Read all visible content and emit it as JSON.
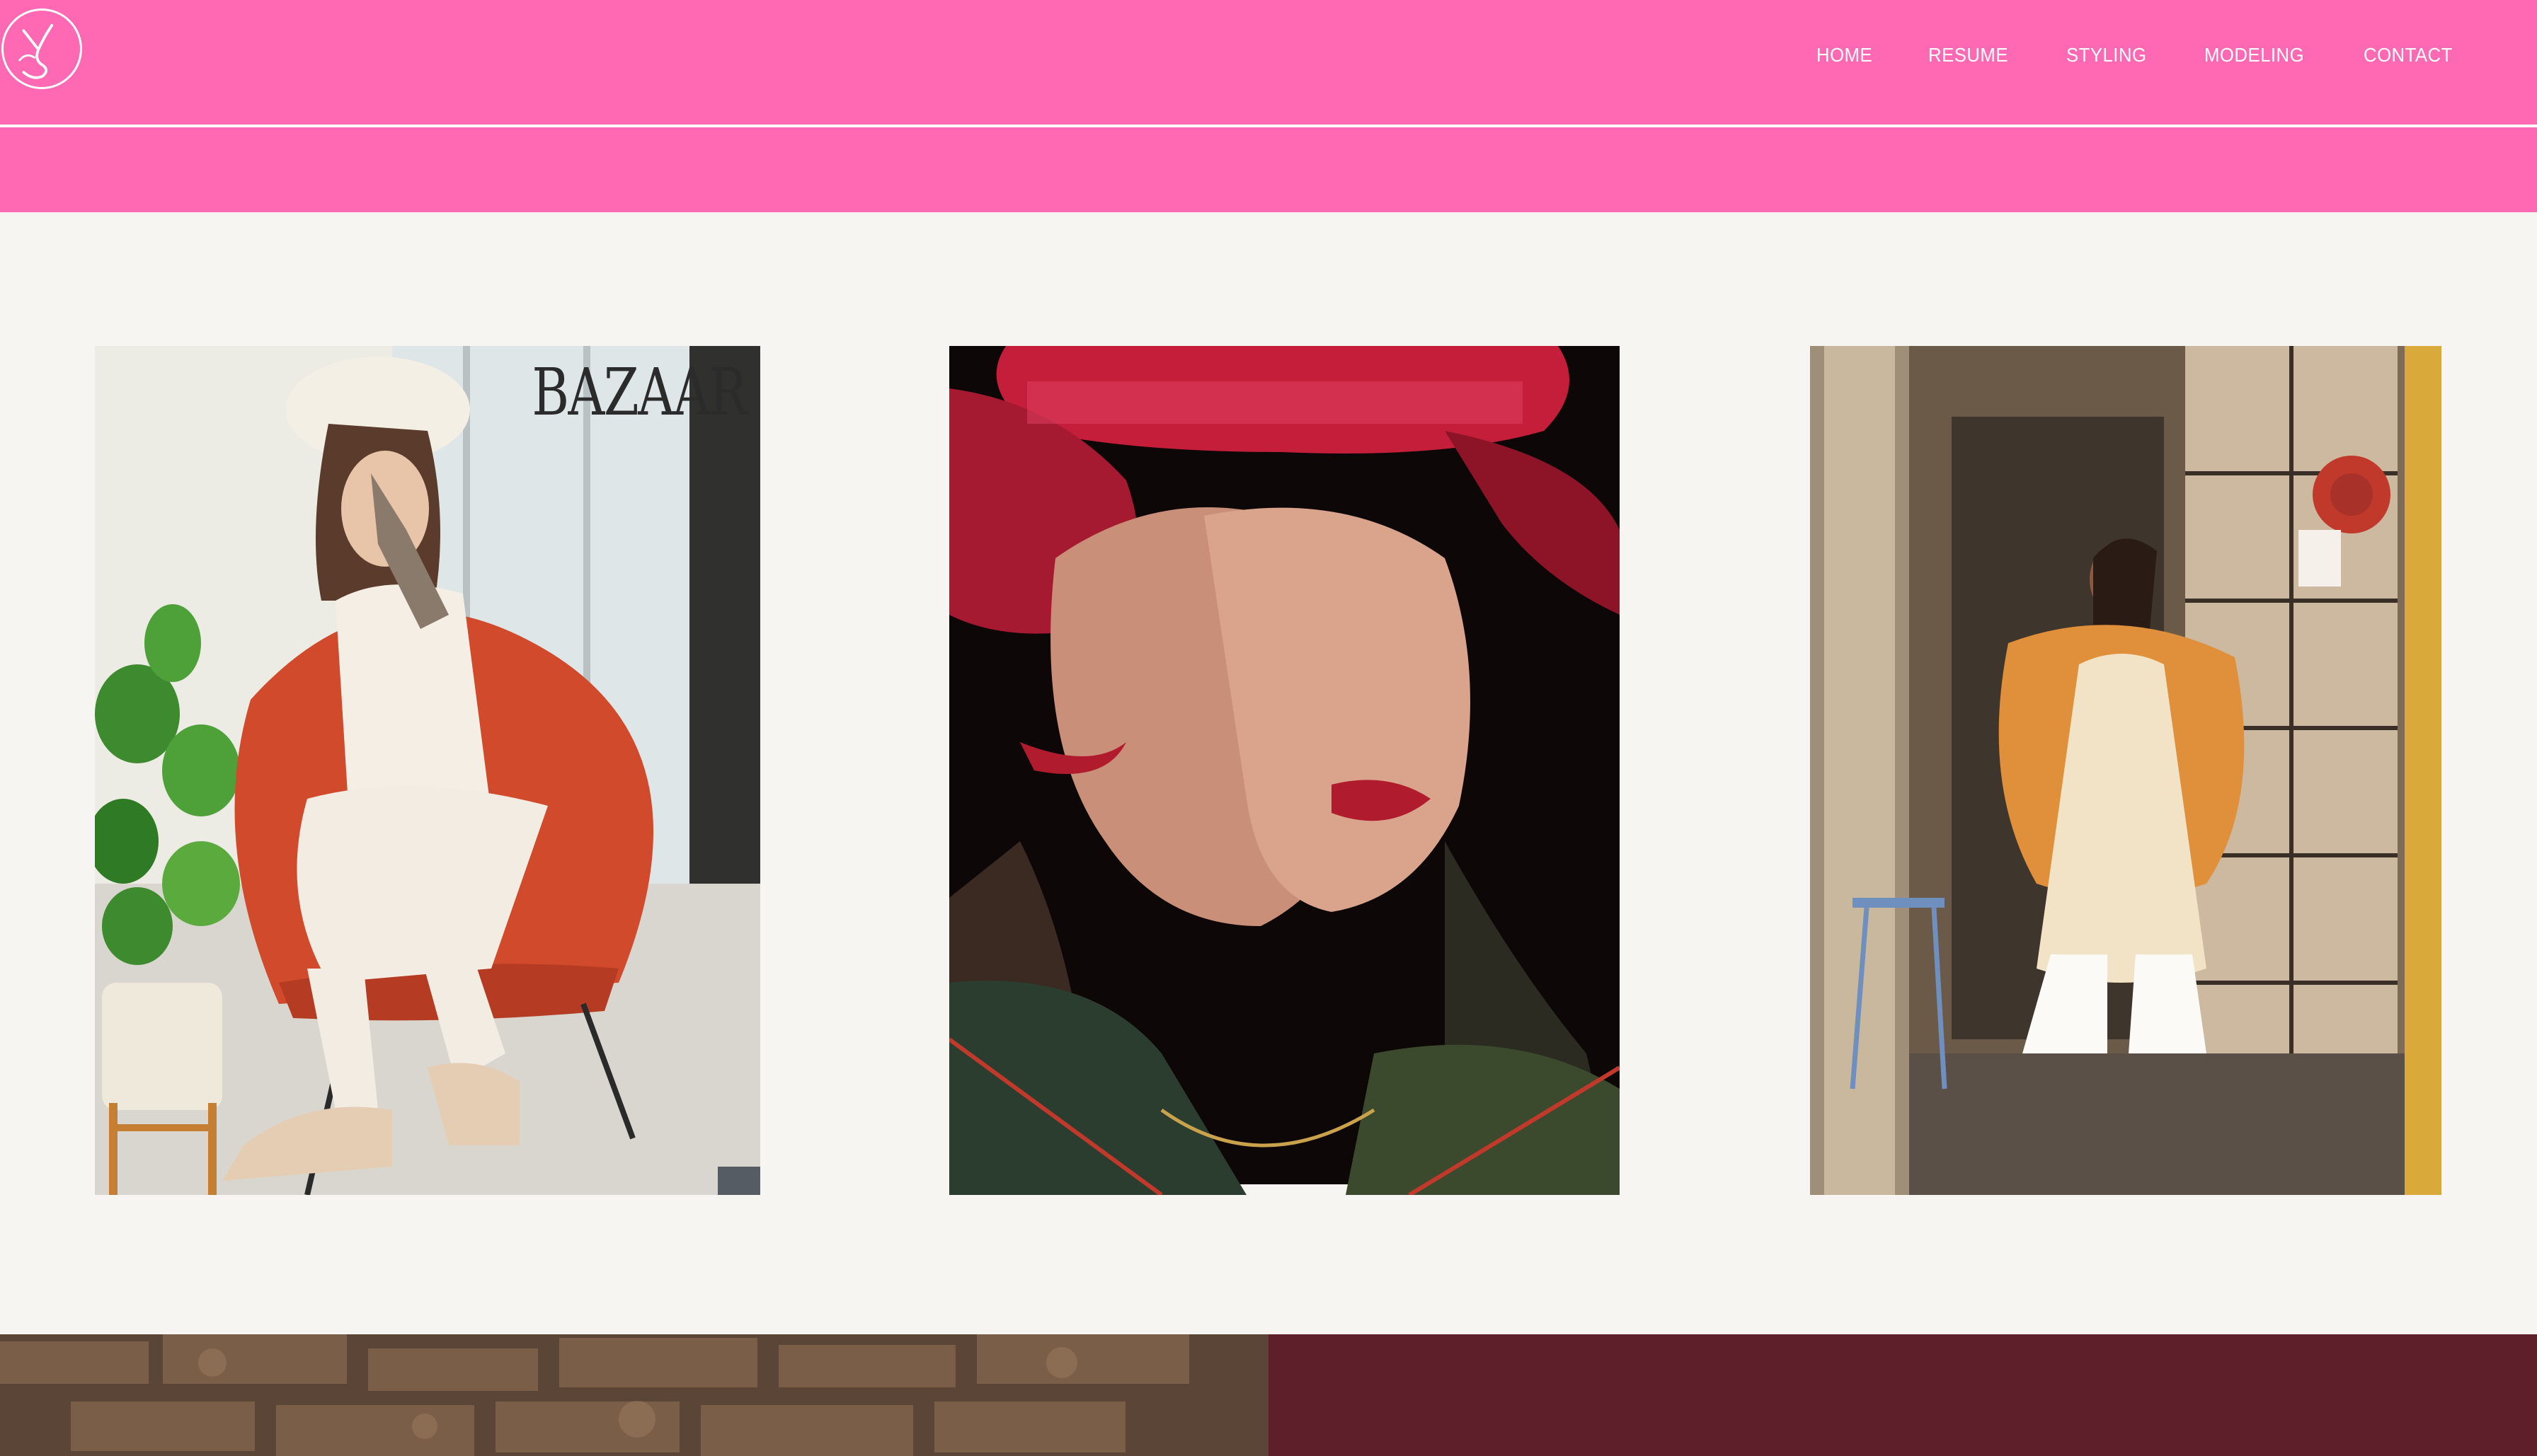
{
  "header": {
    "background_color": "#ff69b4",
    "logo": {
      "icon": "monogram-logo-icon",
      "letters": "KS"
    },
    "nav": [
      {
        "label": "HOME"
      },
      {
        "label": "RESUME"
      },
      {
        "label": "STYLING"
      },
      {
        "label": "MODELING"
      },
      {
        "label": "CONTACT"
      }
    ]
  },
  "gallery": [
    {
      "subject": "model-in-red-chair",
      "cover_text": "BAZAAR"
    },
    {
      "subject": "model-in-red-hat"
    },
    {
      "subject": "model-in-doorway"
    }
  ],
  "footer": {
    "left": "brick-wall-photo",
    "right_color": "#5e1f2b"
  }
}
